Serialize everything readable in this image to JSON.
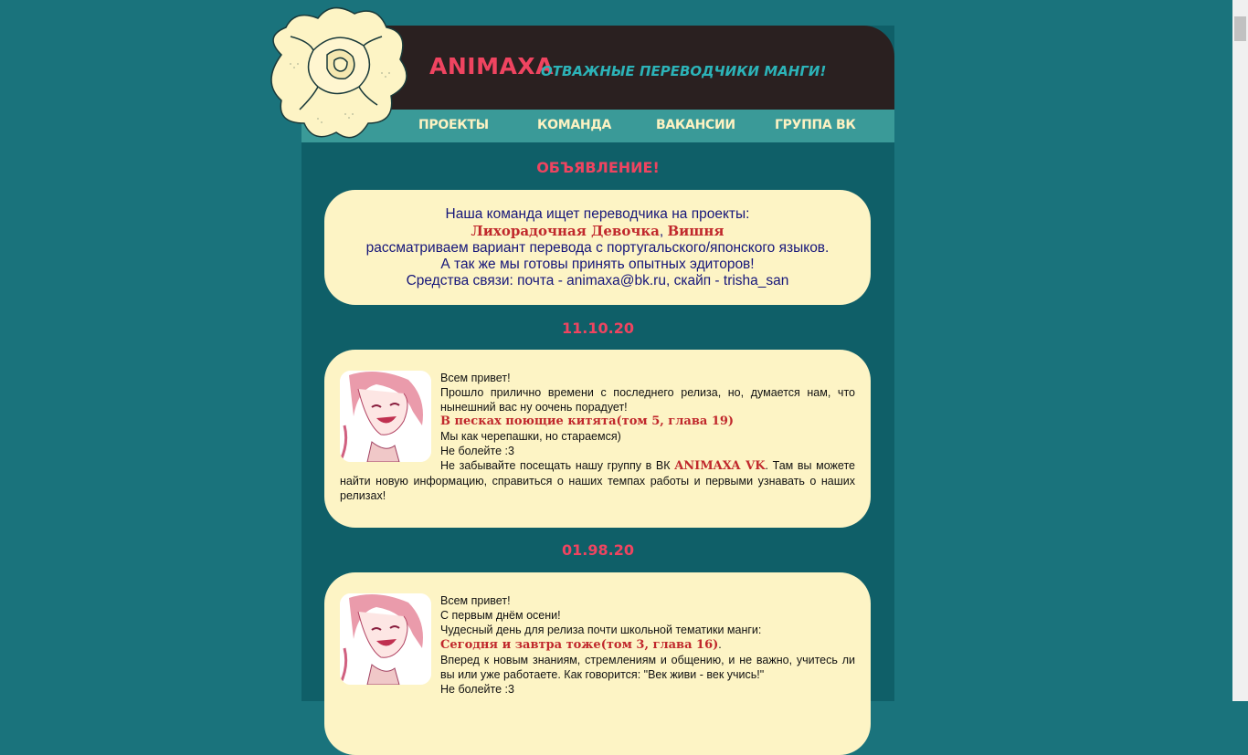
{
  "brand": {
    "name": "ANIMAXA",
    "tagline": "ОТВАЖНЫЕ ПЕРЕВОДЧИКИ МАНГИ!"
  },
  "nav": [
    {
      "label": "ПРОЕКТЫ"
    },
    {
      "label": "КОМАНДА"
    },
    {
      "label": "ВАКАНСИИ"
    },
    {
      "label": "ГРУППА ВК"
    }
  ],
  "announcement": {
    "heading": "ОБЪЯВЛЕНИЕ!",
    "line1": "Наша команда ищет переводчика на проекты:",
    "project1": "Лихорадочная Девочка",
    "separator": ", ",
    "project2": "Вишня",
    "line3": "рассматриваем вариант перевода с португальского/японского языков.",
    "line4": "А так же мы готовы принять опытных эдиторов!",
    "line5": "Средства связи: почта - animaxa@bk.ru, скайп - trisha_san"
  },
  "posts": [
    {
      "date": "11.10.20",
      "greeting": "Всем привет!",
      "text1": "Прошло прилично времени с последнего релиза, но, думается нам, что нынешний вас ну оочень порадует!",
      "release": "В песках поющие китята(том 5, глава 19)",
      "text2": "Мы как черепашки, но стараемся)",
      "text3": "Не болейте :3",
      "text4_before": "Не забывайте посещать нашу группу в ВК ",
      "vk_link": "ANIMAXA VK",
      "text4_after": ". Там вы можете найти новую информацию, справиться о наших темпах работы и первыми узнавать о наших релизах!"
    },
    {
      "date": "01.98.20",
      "greeting": "Всем привет!",
      "text1": "С первым днём осени!",
      "text2": "Чудесный день для релиза почти школьной тематики манги:",
      "release": "Сегодня и завтра тоже(том 3, глава 16)",
      "release_suffix": ".",
      "text3": "Вперед к новым знаниям, стремлениям и общению, и не важно, учитесь ли вы или уже работаете. Как говорится: \"Век живи - век учись!\"",
      "text4": "Не болейте :3"
    }
  ],
  "colors": {
    "background": "#1a737c",
    "page": "#0f5f68",
    "header": "#2a2020",
    "nav": "#3a9a98",
    "card": "#fdf4c5",
    "accent": "#ef4460",
    "link": "#c0282c"
  }
}
